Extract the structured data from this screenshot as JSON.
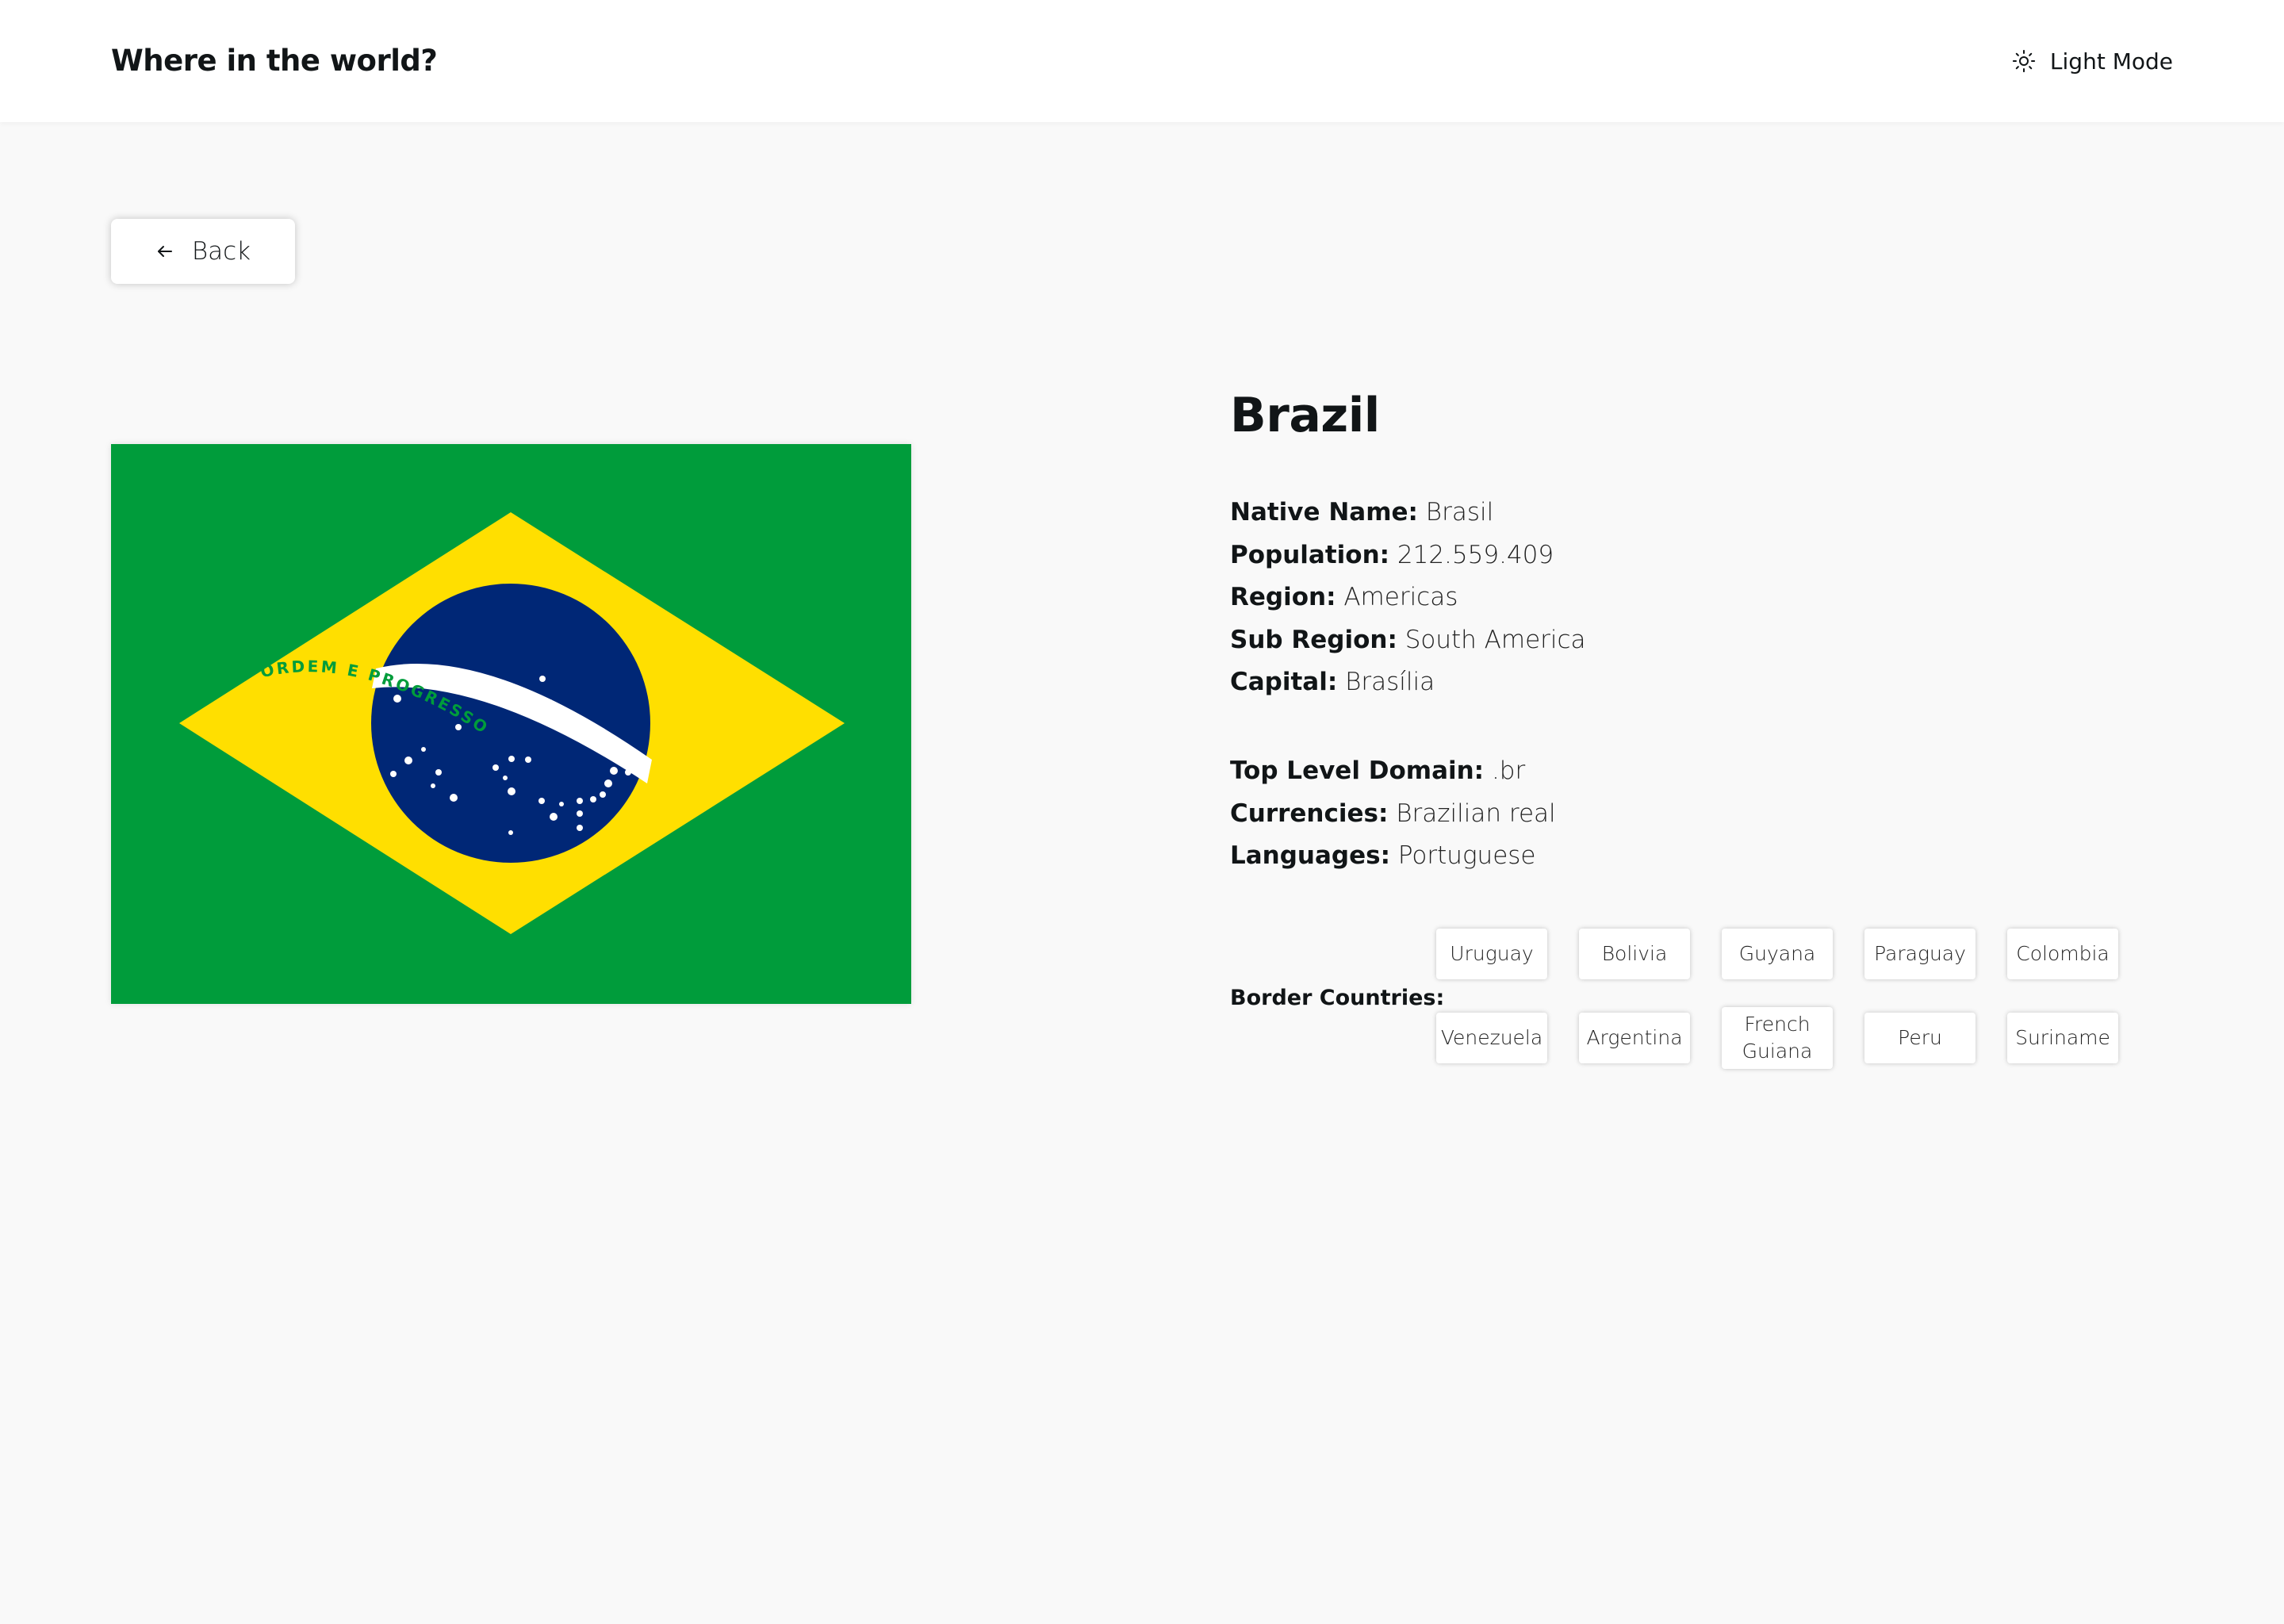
{
  "header": {
    "title": "Where in the world?",
    "theme_toggle_label": "Light Mode",
    "theme_icon": "sun-icon"
  },
  "back_button": {
    "label": "Back",
    "icon": "arrow-left-icon"
  },
  "country": {
    "name": "Brazil",
    "flag": {
      "description_icon": "brazil-flag",
      "motto": "ORDEM E PROGRESSO",
      "colors": {
        "green": "#009c3b",
        "yellow": "#ffdf00",
        "blue": "#002776",
        "white": "#ffffff"
      }
    },
    "primary_info": [
      {
        "label": "Native Name:",
        "value": "Brasil"
      },
      {
        "label": "Population:",
        "value": "212.559.409"
      },
      {
        "label": "Region:",
        "value": "Americas"
      },
      {
        "label": "Sub Region:",
        "value": "South America"
      },
      {
        "label": "Capital:",
        "value": "Brasília"
      }
    ],
    "secondary_info": [
      {
        "label": "Top Level Domain:",
        "value": ".br"
      },
      {
        "label": "Currencies:",
        "value": "Brazilian real"
      },
      {
        "label": "Languages:",
        "value": "Portuguese"
      }
    ],
    "border_label": "Border Countries:",
    "border_countries": [
      "Uruguay",
      "Bolivia",
      "Guyana",
      "Paraguay",
      "Colombia",
      "Venezuela",
      "Argentina",
      "French Guiana",
      "Peru",
      "Suriname"
    ]
  },
  "colors": {
    "background": "#f9f9f9",
    "surface": "#ffffff",
    "text": "#111517"
  }
}
